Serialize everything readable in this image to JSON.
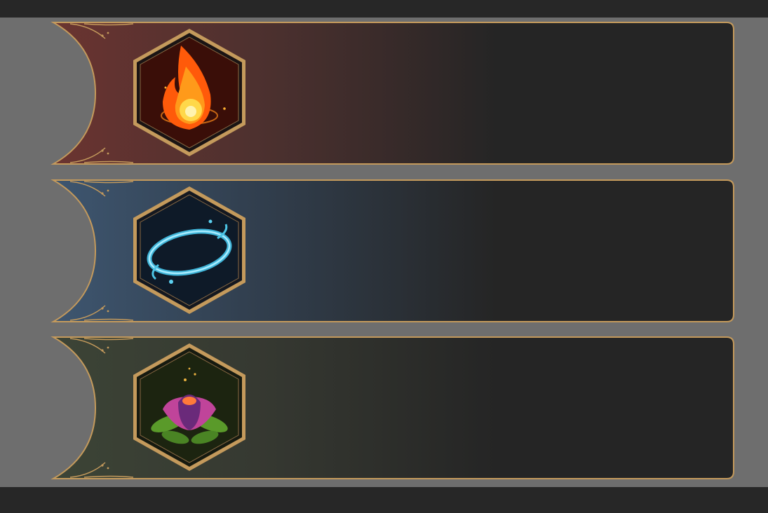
{
  "colors": {
    "background": "#6e6e6e",
    "frame_bar": "#272727",
    "card_base": "#252525",
    "gold_border": "#c49a5c"
  },
  "cards": [
    {
      "element": "fire",
      "icon": "fire-icon",
      "tint": "#6b3430",
      "gem_bg": "#3a0e08"
    },
    {
      "element": "water",
      "icon": "water-ring-icon",
      "tint": "#3e5670",
      "gem_bg": "#0e1a28"
    },
    {
      "element": "nature",
      "icon": "flower-icon",
      "tint": "#3c4436",
      "gem_bg": "#1c2410"
    }
  ]
}
